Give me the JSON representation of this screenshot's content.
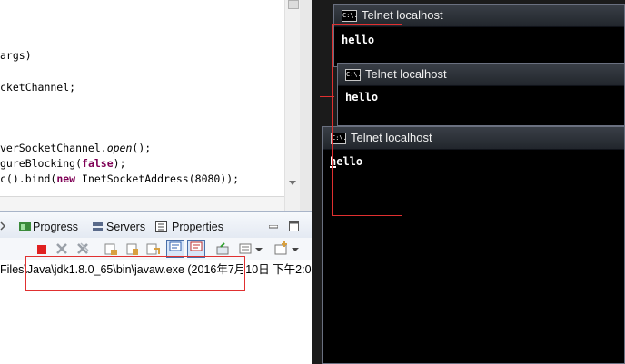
{
  "editor": {
    "lines": [
      {
        "text": "args)"
      },
      {
        "text": "cketChannel;"
      },
      {
        "pre": "verSocketChannel.",
        "italic": "open",
        "post": "();"
      },
      {
        "pre": "gureBlocking(",
        "kw": "false",
        "post": ");"
      },
      {
        "pre": "c().bind(",
        "kw": "new",
        "post": " InetSocketAddress(8080));"
      }
    ]
  },
  "console": {
    "tabs": [
      {
        "label": "Progress",
        "icon": "progress-icon"
      },
      {
        "label": "Servers",
        "icon": "servers-icon"
      },
      {
        "label": "Properties",
        "icon": "properties-icon"
      }
    ],
    "title": "Files\\Java\\jdk1.8.0_65\\bin\\javaw.exe (2016年7月10日 下午2:0"
  },
  "telnet": {
    "windows": [
      {
        "title": "Telnet localhost",
        "icon_text": "C:\\.",
        "line": "hello"
      },
      {
        "title": "Telnet localhost",
        "icon_text": "C:\\.",
        "line": "hello"
      },
      {
        "title": "Telnet localhost",
        "icon_text": "C:\\.",
        "line": "hello"
      }
    ]
  },
  "colors": {
    "annotation": "#e03030",
    "keyword": "#7f0055",
    "terminal_bg": "#000000"
  }
}
